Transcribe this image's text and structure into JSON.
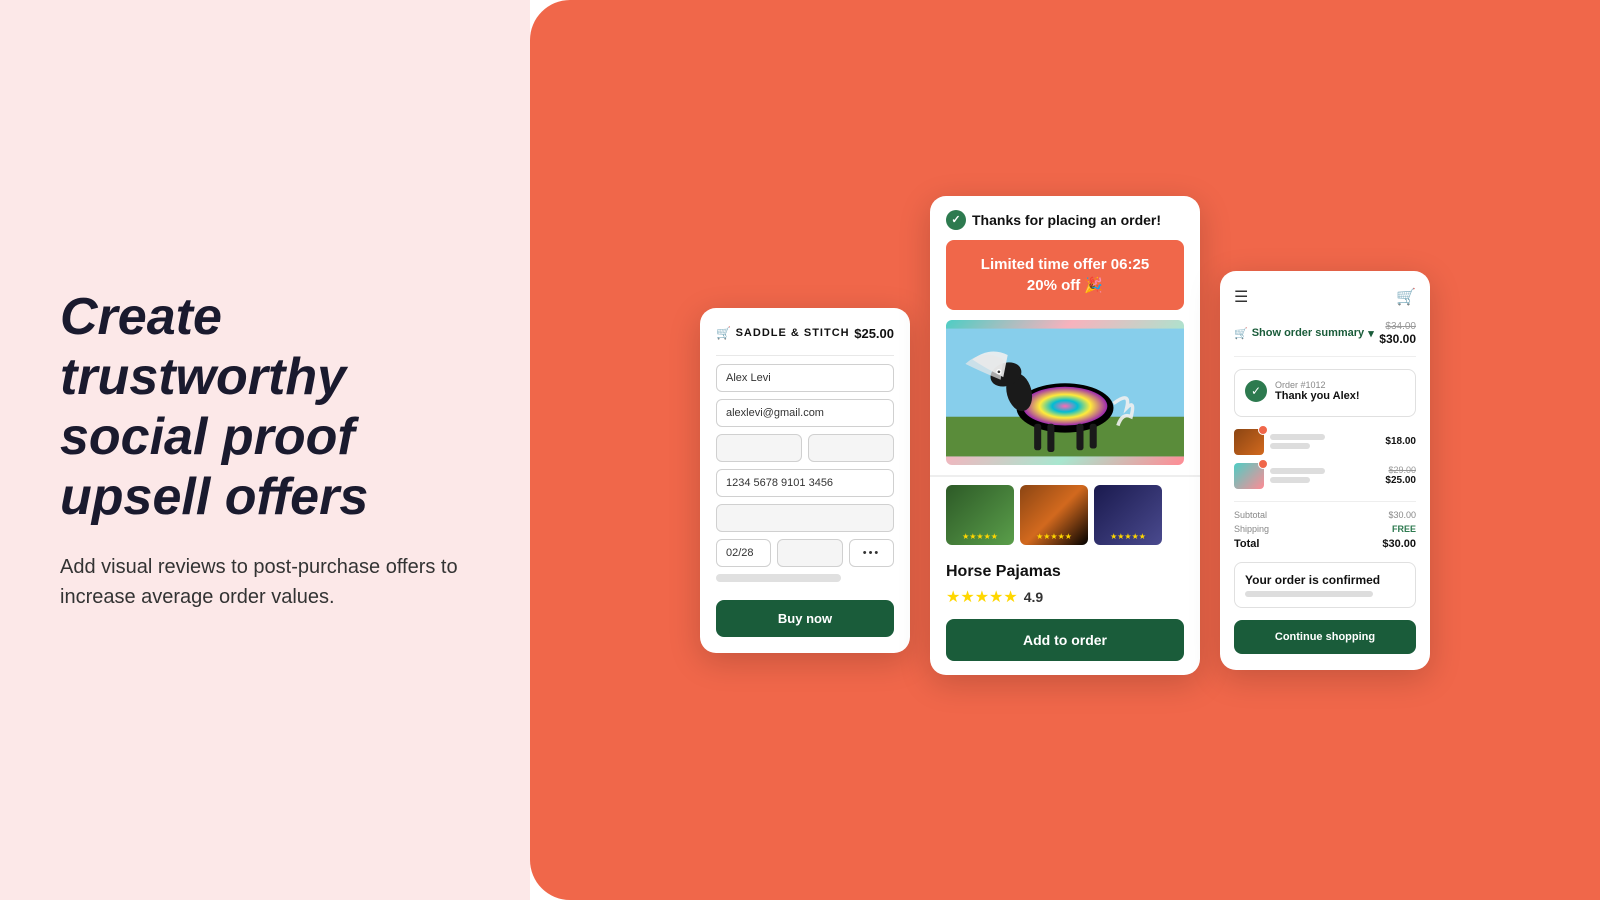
{
  "left": {
    "headline": "Create trustworthy social proof upsell offers",
    "subtext": "Add visual reviews to post-purchase offers to increase average order values."
  },
  "card1": {
    "logo": "SADDLE & STITCH",
    "price": "$25.00",
    "name_placeholder": "Alex Levi",
    "email_placeholder": "alexlevi@gmail.com",
    "card_number": "1234 5678 9101 3456",
    "date_value": "02/28",
    "dots_value": "•••",
    "buy_label": "Buy now"
  },
  "card2": {
    "thanks_text": "Thanks for placing an order!",
    "offer_line1": "Limited time offer 06:25",
    "offer_line2": "20% off 🎉",
    "product_name": "Horse Pajamas",
    "rating": "4.9",
    "stars": "★★★★★",
    "add_to_order_label": "Add to order"
  },
  "card3": {
    "order_summary_label": "Show order summary",
    "price_original": "$34.00",
    "price_current": "$30.00",
    "order_number": "Order #1012",
    "thank_you": "Thank you Alex!",
    "item1_price": "$18.00",
    "item2_price_original": "$29.00",
    "item2_price": "$25.00",
    "subtotal_label": "Subtotal",
    "subtotal_val": "$30.00",
    "shipping_label": "Shipping",
    "shipping_val": "FREE",
    "total_label": "Total",
    "total_val": "$30.00",
    "confirmed_title": "Your order is confirmed",
    "continue_label": "Continue shopping"
  }
}
